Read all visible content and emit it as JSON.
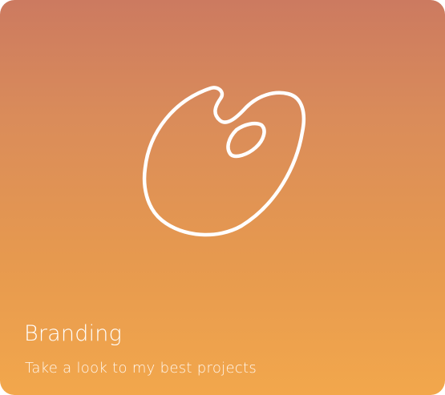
{
  "card": {
    "title": "Branding",
    "subtitle": "Take a look to my best projects",
    "icon": "palette-icon",
    "gradient_top": "#cc7a60",
    "gradient_bottom": "#f2a74c",
    "text_color": "#ffffff"
  }
}
